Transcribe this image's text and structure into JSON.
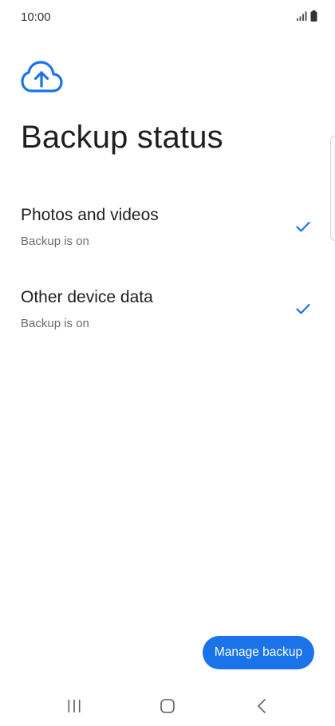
{
  "status_bar": {
    "time": "10:00"
  },
  "header": {
    "icon": "cloud-upload-icon",
    "title": "Backup status"
  },
  "items": [
    {
      "title": "Photos and videos",
      "subtitle": "Backup is on",
      "icon": "check-icon"
    },
    {
      "title": "Other device data",
      "subtitle": "Backup is on",
      "icon": "check-icon"
    }
  ],
  "actions": {
    "manage_label": "Manage backup"
  },
  "nav": {
    "recents": "recents-icon",
    "home": "home-icon",
    "back": "back-icon"
  },
  "colors": {
    "accent": "#1a73e8",
    "text": "#1f1f1f",
    "secondary_text": "#6b6b6b"
  }
}
